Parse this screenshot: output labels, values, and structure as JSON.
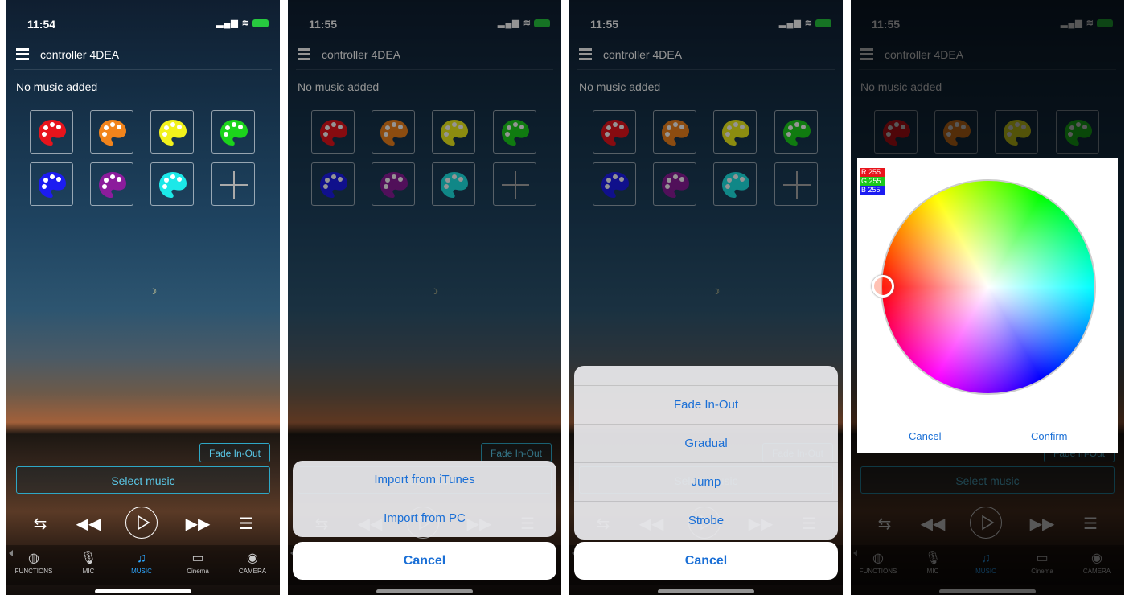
{
  "screens": [
    {
      "time": "11:54"
    },
    {
      "time": "11:55"
    },
    {
      "time": "11:55"
    },
    {
      "time": "11:55"
    }
  ],
  "device_name": "controller 4DEA",
  "no_music_text": "No music added",
  "palette_colors": [
    "#e8141c",
    "#f2841c",
    "#f2f21c",
    "#1cd41c",
    "#1c1cf2",
    "#8c1c9c",
    "#1ce8e8"
  ],
  "fade_button": "Fade In-Out",
  "select_music": "Select music",
  "tabs": [
    {
      "label": "FUNCTIONS",
      "icon": "functions-icon"
    },
    {
      "label": "MIC",
      "icon": "mic-icon"
    },
    {
      "label": "MUSIC",
      "icon": "music-icon"
    },
    {
      "label": "Cinema",
      "icon": "cinema-icon"
    },
    {
      "label": "CAMERA",
      "icon": "camera-icon"
    }
  ],
  "import_sheet": {
    "options": [
      "Import from iTunes",
      "Import from PC"
    ],
    "cancel": "Cancel"
  },
  "mode_sheet": {
    "options": [
      "Fade In-Out",
      "Gradual",
      "Jump",
      "Strobe"
    ],
    "cancel": "Cancel"
  },
  "color_dialog": {
    "rgb": {
      "r": "R 255",
      "g": "G 255",
      "b": "B 255"
    },
    "cancel": "Cancel",
    "confirm": "Confirm"
  },
  "colors": {
    "accent": "#2ea7c6",
    "ios_blue": "#1a6fd6",
    "active_tab": "#2ea7ff"
  }
}
